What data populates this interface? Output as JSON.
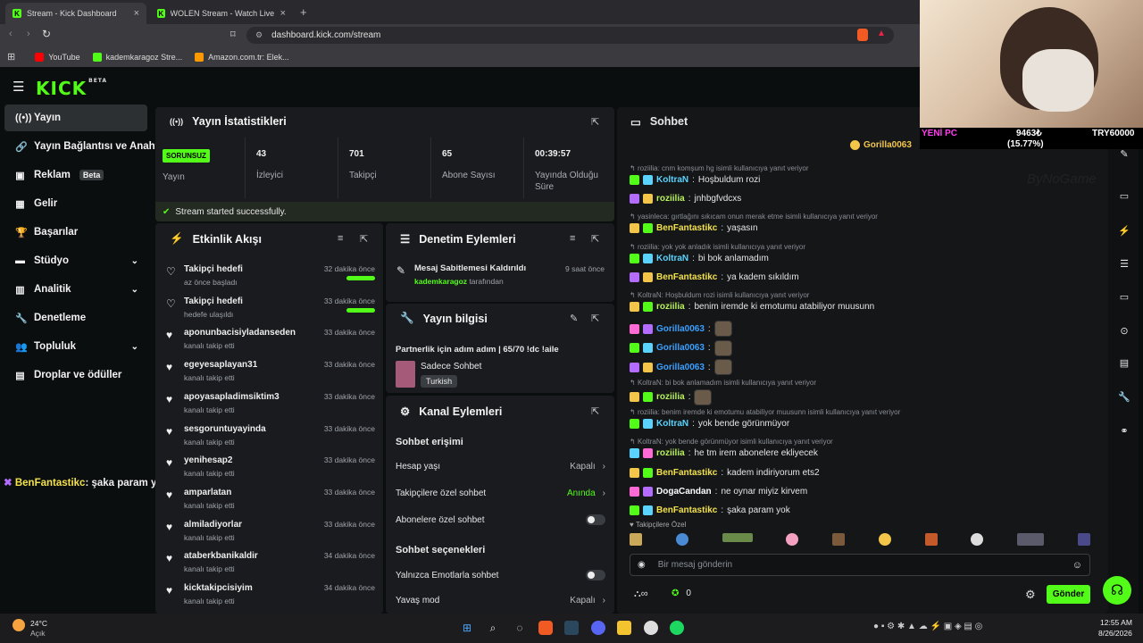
{
  "browser": {
    "tabs": [
      {
        "title": "Stream - Kick Dashboard",
        "active": true
      },
      {
        "title": "WOLEN Stream - Watch Live on K",
        "active": false
      }
    ],
    "url": "dashboard.kick.com/stream",
    "bookmarks": [
      "YouTube",
      "kademkaragoz Stre...",
      "Amazon.com.tr: Elek..."
    ]
  },
  "kick": {
    "logo": "KICK",
    "logo_sup": "BETA"
  },
  "sidebar": {
    "items": [
      {
        "label": "Yayın"
      },
      {
        "label": "Yayın Bağlantısı ve Anahtarı"
      },
      {
        "label": "Reklam",
        "badge": "Beta"
      },
      {
        "label": "Gelir"
      },
      {
        "label": "Başarılar"
      },
      {
        "label": "Stüdyo"
      },
      {
        "label": "Analitik"
      },
      {
        "label": "Denetleme"
      },
      {
        "label": "Topluluk"
      },
      {
        "label": "Droplar ve ödüller"
      }
    ]
  },
  "stats": {
    "title": "Yayın İstatistikleri",
    "status_badge": "SORUNSUZ",
    "status_label": "Yayın",
    "viewers": "43",
    "viewers_label": "İzleyici",
    "followers": "701",
    "followers_label": "Takipçi",
    "subs": "65",
    "subs_label": "Abone Sayısı",
    "duration": "00:39:57",
    "duration_label": "Yayında Olduğu Süre",
    "success": "Stream started successfully."
  },
  "activity": {
    "title": "Etkinlik Akışı",
    "items": [
      {
        "name": "Takipçi hedefi",
        "sub": "az önce başladı",
        "time": "32 dakika önce",
        "bar": true
      },
      {
        "name": "Takipçi hedefi",
        "sub": "hedefe ulaşıldı",
        "time": "33 dakika önce",
        "bar": true
      },
      {
        "name": "aponunbacisiyladanseden",
        "sub": "kanalı takip etti",
        "time": "33 dakika önce"
      },
      {
        "name": "egeyesaplayan31",
        "sub": "kanalı takip etti",
        "time": "33 dakika önce"
      },
      {
        "name": "apoyasapladimsiktim3",
        "sub": "kanalı takip etti",
        "time": "33 dakika önce"
      },
      {
        "name": "sesgoruntuyayinda",
        "sub": "kanalı takip etti",
        "time": "33 dakika önce"
      },
      {
        "name": "yenihesap2",
        "sub": "kanalı takip etti",
        "time": "33 dakika önce"
      },
      {
        "name": "amparlatan",
        "sub": "kanalı takip etti",
        "time": "33 dakika önce"
      },
      {
        "name": "almiladiyorlar",
        "sub": "kanalı takip etti",
        "time": "33 dakika önce"
      },
      {
        "name": "ataberkbanikaldir",
        "sub": "kanalı takip etti",
        "time": "34 dakika önce"
      },
      {
        "name": "kicktakipcisiyim",
        "sub": "kanalı takip etti",
        "time": "34 dakika önce"
      }
    ]
  },
  "moderation": {
    "title": "Denetim Eylemleri",
    "action": "Mesaj Sabitlemesi Kaldırıldı",
    "time": "9 saat önce",
    "by_user": "kademkaragoz",
    "by_suffix": "tarafından"
  },
  "stream_info": {
    "title": "Yayın bilgisi",
    "stream_title": "Partnerlik için adım adım | 65/70 !dc !aile",
    "category": "Sadece Sohbet",
    "language": "Turkish"
  },
  "channel": {
    "title": "Kanal Eylemleri",
    "section1": "Sohbet erişimi",
    "rows": [
      {
        "label": "Hesap yaşı",
        "value": "Kapalı"
      },
      {
        "label": "Takipçilere özel sohbet",
        "value": "Anında"
      },
      {
        "label": "Abonelere özel sohbet",
        "value": ""
      }
    ],
    "section2": "Sohbet seçenekleri",
    "rows2": [
      {
        "label": "Yalnızca Emotlarla sohbet",
        "value": ""
      },
      {
        "label": "Yavaş mod",
        "value": "Kapalı"
      }
    ]
  },
  "chat": {
    "title": "Sohbet",
    "top_user": "Gorilla0063",
    "messages": [
      {
        "reply": "roziilia: cnm komşum hg isimli kullanıcıya yanıt veriyor"
      },
      {
        "user": "KoltraN",
        "text": "Hoşbuldum rozi",
        "color": "#5ad4ff"
      },
      {
        "user": "roziilia",
        "text": "jnhbgfvdcxs",
        "color": "#b9f25a"
      },
      {
        "reply": "yasinleca: gırtlağını sıkıcam onun merak etme isimli kullanıcıya yanıt veriyor"
      },
      {
        "user": "BenFantastikc",
        "text": "yaşasın",
        "color": "#f3e24a"
      },
      {
        "reply": "roziilia: yok yok anladık isimli kullanıcıya yanıt veriyor"
      },
      {
        "user": "KoltraN",
        "text": "bi bok anlamadım",
        "color": "#5ad4ff"
      },
      {
        "user": "BenFantastikc",
        "text": "ya kadem sıkıldım",
        "color": "#f3e24a"
      },
      {
        "reply": "KoltraN: Hoşbuldum rozi isimli kullanıcıya yanıt veriyor"
      },
      {
        "user": "roziilia",
        "text": "benim iremde ki emotumu atabiliyor muusunn",
        "color": "#b9f25a"
      },
      {
        "user": "Gorilla0063",
        "text": "",
        "color": "#3aa0ff",
        "emote": true
      },
      {
        "user": "Gorilla0063",
        "text": "",
        "color": "#3aa0ff",
        "emote": true
      },
      {
        "user": "Gorilla0063",
        "text": "",
        "color": "#3aa0ff",
        "emote": true
      },
      {
        "reply": "KoltraN: bi bok anlamadım isimli kullanıcıya yanıt veriyor"
      },
      {
        "user": "roziilia",
        "text": "",
        "color": "#b9f25a",
        "emote": true
      },
      {
        "reply": "roziilia: benim iremde ki emotumu atabiliyor muusunn isimli kullanıcıya yanıt veriyor"
      },
      {
        "user": "KoltraN",
        "text": "yok bende görünmüyor",
        "color": "#5ad4ff"
      },
      {
        "reply": "KoltraN: yok bende görünmüyor isimli kullanıcıya yanıt veriyor"
      },
      {
        "user": "roziilia",
        "text": "he tm irem abonelere ekliyecek",
        "color": "#b9f25a"
      },
      {
        "user": "BenFantastikc",
        "text": "kadem indiriyorum ets2",
        "color": "#f3e24a"
      },
      {
        "user": "DogaCandan",
        "text": "ne oynar miyiz kirvem",
        "color": "#ffffff"
      },
      {
        "user": "BenFantastikc",
        "text": "şaka param yok",
        "color": "#f3e24a"
      }
    ],
    "followers_only": "Takipçilere Özel",
    "placeholder": "Bir mesaj gönderin",
    "points": "0",
    "send": "Gönder"
  },
  "overlay": {
    "chat_user": "BenFantastikc",
    "chat_text": ": şaka param yok",
    "cam_label_left": "YENİ PC",
    "cam_value": "9463₺",
    "cam_percent": "(15.77%)",
    "cam_goal": "TRY60000",
    "watermark": "ByNoGame"
  },
  "taskbar": {
    "temp": "24°C",
    "weather": "Açık",
    "time": "12:55 AM",
    "date": "8/26/2026"
  }
}
